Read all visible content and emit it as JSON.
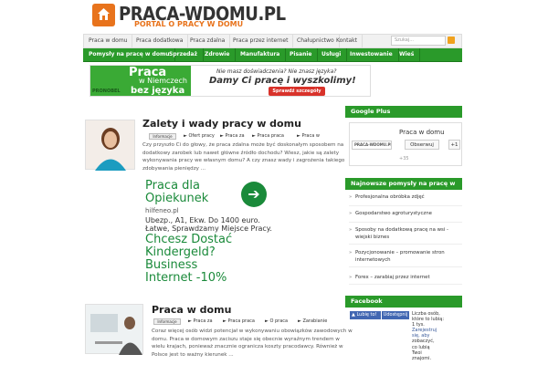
{
  "header": {
    "logo_title": "PRACA-WDOMU.PL",
    "logo_subtitle": "PORTAL O PRACY W DOMU"
  },
  "topnav": {
    "items": [
      "Praca w domu",
      "Praca dodatkowa",
      "Praca zdalna",
      "Praca przez internet",
      "Chałupnictwo",
      "Kontakt"
    ],
    "search_placeholder": "Szukaj..."
  },
  "greennav": {
    "items": [
      "Pomysły na pracę w domu",
      "Sprzedaż",
      "Zdrowie",
      "Manufaktura",
      "Pisanie",
      "Usługi",
      "Inwestowanie",
      "Wieś"
    ]
  },
  "banner": {
    "praca": "Praca",
    "niemczech": "w Niemczech",
    "bez": "bez języka",
    "logo": "PRONOBEL",
    "question": "Nie masz doświadczenia? Nie znasz języka?",
    "damy": "Damy Ci pracę i wyszkolimy!",
    "button": "Sprawdź szczegóły"
  },
  "posts": [
    {
      "title": "Zalety i wady pracy w domu",
      "badge": "Informacje",
      "tags": [
        "Ofert pracy",
        "Praca za",
        "Praca praca",
        "Praca w"
      ],
      "excerpt_lines": [
        "Czy przyszło Ci do głowy, że praca zdalna może być doskonałym sposobem na",
        "dodatkowy zarobek lub nawet główne źródło dochodu? Wiesz, jakie są zalety",
        "wykonywania pracy we własnym domu? A czy znasz wady i zagrożenia takiego",
        "zdobywania pieniędzy ..."
      ]
    },
    {
      "title": "Praca w domu",
      "badge": "Informacje",
      "tags": [
        "Praca za",
        "Praca praca",
        "O praca",
        "Zarabianie"
      ],
      "excerpt_lines": [
        "Coraz więcej osób widzi potencjał w wykonywaniu obowiązków zawodowych w",
        "domu. Praca w domowym zaciszu staje się obecnie wyraźnym trendem w",
        "wielu krajach, ponieważ znacznie ogranicza koszty pracodawcy. Również w",
        "Polsce jest to ważny kierunek ..."
      ]
    }
  ],
  "ad": {
    "headline1": "Praca dla",
    "headline2": "Opiekunek",
    "url": "hilfeneo.pl",
    "text1": "Ubezp., A1, Ekw. Do 1400 euro.",
    "text2": "Łatwe, Sprawdzamy Miejsce Pracy.",
    "big1": "Chcesz Dostać",
    "big2": "Kindergeld?",
    "big3": "Business",
    "big4": "Internet -10%"
  },
  "sidebar": {
    "gplus_head": "Google Plus",
    "gplus_name": "Praca w domu",
    "gplus_follow": "Obserwuj",
    "gplus_plus": "+1",
    "gplus_count": "+35",
    "newest_head": "Najnowsze pomysły na pracę w",
    "newest_items": [
      "Profesjonalna obróbka zdjęć",
      "Gospodarstwo agroturystyczne",
      "Sposoby na dodatkową pracę na wsi - wiejski biznes",
      "Pozycjonowanie – promowanie stron internetowych",
      "Forex – zarabiaj przez internet"
    ],
    "fb_head": "Facebook",
    "fb_like": "Lubię to!",
    "fb_share": "Udostępnij",
    "fb_text": [
      "Liczba osób,",
      "które to lubią:",
      "1 tys.",
      "Zarejestruj",
      "się, aby",
      "zobaczyć,",
      "co lubią",
      "Twoi",
      "znajomi."
    ]
  },
  "colors": {
    "green": "#2a9a2a",
    "orange": "#e8731c"
  }
}
